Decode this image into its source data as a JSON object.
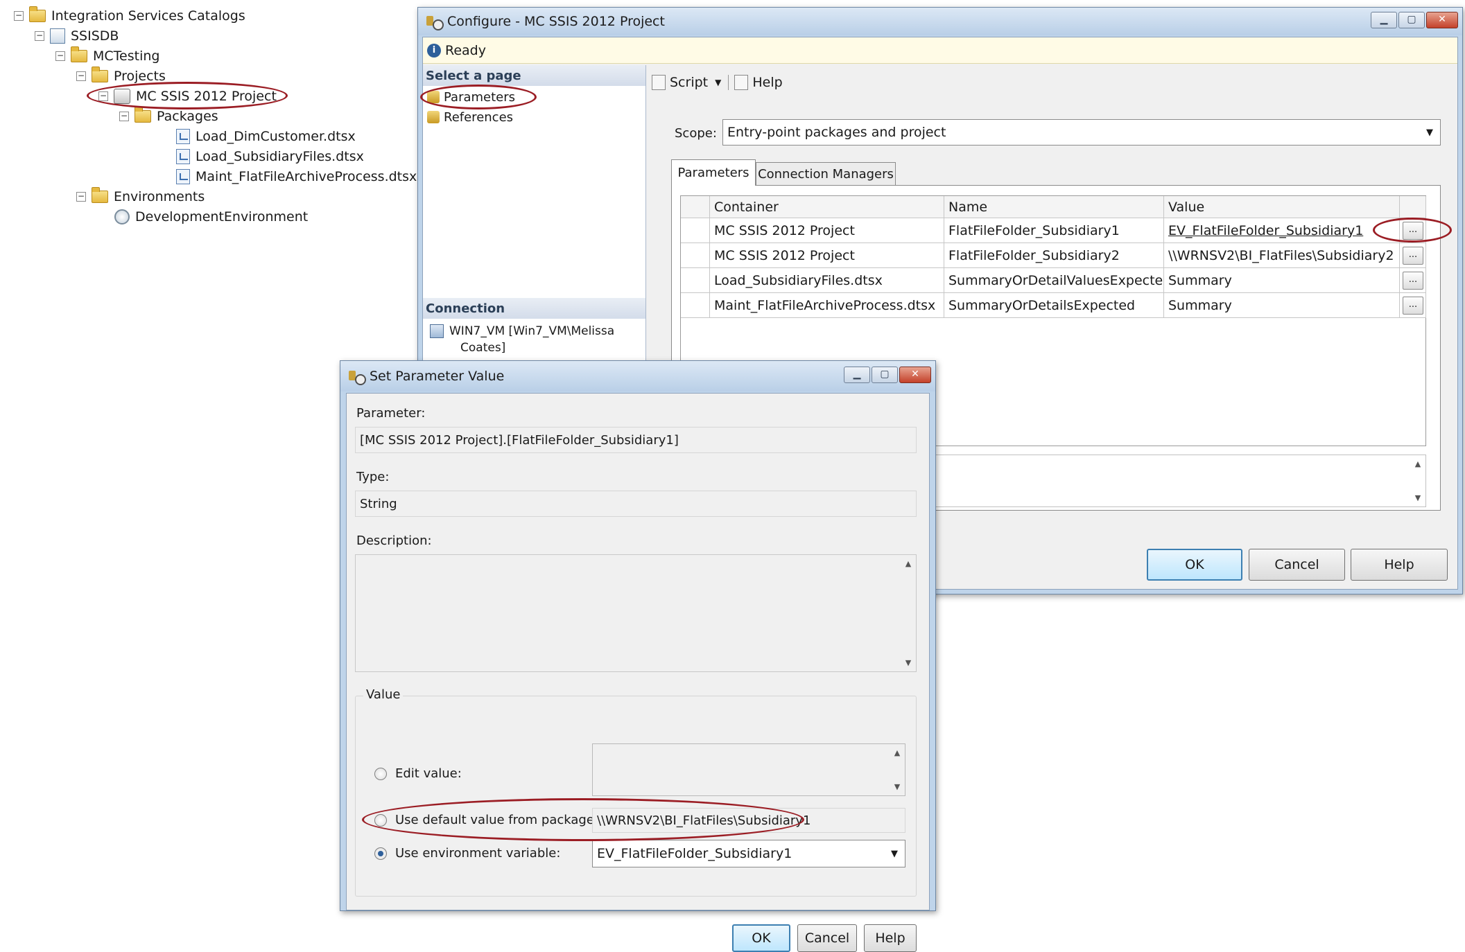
{
  "tree": {
    "root": "Integration Services Catalogs",
    "ssisdb": "SSISDB",
    "folder": "MCTesting",
    "projects": "Projects",
    "project": "MC SSIS 2012 Project",
    "packages": "Packages",
    "package_items": [
      "Load_DimCustomer.dtsx",
      "Load_SubsidiaryFiles.dtsx",
      "Maint_FlatFileArchiveProcess.dtsx"
    ],
    "environments": "Environments",
    "environment": "DevelopmentEnvironment"
  },
  "configure": {
    "title": "Configure - MC SSIS 2012 Project",
    "status": "Ready",
    "select_page_header": "Select a page",
    "pages": [
      "Parameters",
      "References"
    ],
    "connection_header": "Connection",
    "connection_line1": "WIN7_VM [Win7_VM\\Melissa",
    "connection_line2": "Coates]",
    "toolbar": {
      "script": "Script",
      "help": "Help"
    },
    "scope_label": "Scope:",
    "scope_value": "Entry-point packages and project",
    "tabs": [
      "Parameters",
      "Connection Managers"
    ],
    "columns": [
      "Container",
      "Name",
      "Value"
    ],
    "rows": [
      {
        "container": "MC SSIS 2012 Project",
        "name": "FlatFileFolder_Subsidiary1",
        "value": "EV_FlatFileFolder_Subsidiary1"
      },
      {
        "container": "MC SSIS 2012 Project",
        "name": "FlatFileFolder_Subsidiary2",
        "value": "\\\\WRNSV2\\BI_FlatFiles\\Subsidiary2"
      },
      {
        "container": "Load_SubsidiaryFiles.dtsx",
        "name": "SummaryOrDetailValuesExpected",
        "value": "Summary"
      },
      {
        "container": "Maint_FlatFileArchiveProcess.dtsx",
        "name": "SummaryOrDetailsExpected",
        "value": "Summary"
      }
    ],
    "ellipsis": "...",
    "buttons": {
      "ok": "OK",
      "cancel": "Cancel",
      "help": "Help"
    }
  },
  "set_param": {
    "title": "Set Parameter Value",
    "parameter_label": "Parameter:",
    "parameter_value": "[MC SSIS 2012 Project].[FlatFileFolder_Subsidiary1]",
    "type_label": "Type:",
    "type_value": "String",
    "description_label": "Description:",
    "value_group": "Value",
    "edit_value_label": "Edit value:",
    "default_label": "Use default value from package",
    "default_value": "\\\\WRNSV2\\BI_FlatFiles\\Subsidiary1",
    "env_label": "Use environment variable:",
    "env_value": "EV_FlatFileFolder_Subsidiary1",
    "buttons": {
      "ok": "OK",
      "cancel": "Cancel",
      "help": "Help"
    }
  },
  "colors": {
    "highlight_oval": "#9b1d24",
    "window_frame": "#bfd4ea",
    "dialog_bg": "#f0f0f0"
  }
}
